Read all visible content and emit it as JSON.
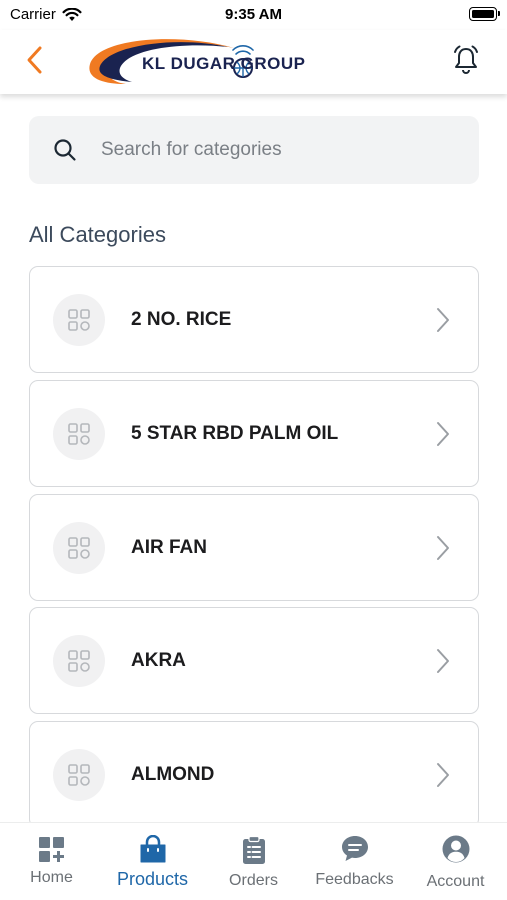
{
  "status_bar": {
    "carrier": "Carrier",
    "time": "9:35 AM"
  },
  "header": {
    "logo_text": "KL DUGAR GR⊕UP",
    "logo_alt": "KL DUGAR GROUP"
  },
  "search": {
    "placeholder": "Search for categories",
    "value": ""
  },
  "section_title": "All Categories",
  "categories": [
    {
      "label": "2 NO. RICE"
    },
    {
      "label": "5 STAR RBD PALM OIL"
    },
    {
      "label": "AIR FAN"
    },
    {
      "label": "AKRA"
    },
    {
      "label": "ALMOND"
    }
  ],
  "tabs": [
    {
      "label": "Home",
      "icon": "home-grid-icon",
      "active": false
    },
    {
      "label": "Products",
      "icon": "shopping-bag-icon",
      "active": true
    },
    {
      "label": "Orders",
      "icon": "clipboard-icon",
      "active": false
    },
    {
      "label": "Feedbacks",
      "icon": "chat-bubble-icon",
      "active": false
    },
    {
      "label": "Account",
      "icon": "user-icon",
      "active": false
    }
  ],
  "colors": {
    "accent_orange": "#f07a22",
    "active_tab": "#1f67a8",
    "inactive_tab": "#6b7075",
    "logo_navy": "#1a2350"
  }
}
